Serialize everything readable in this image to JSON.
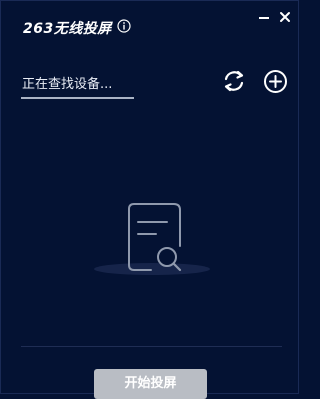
{
  "window": {
    "title": "263无线投屏"
  },
  "status": {
    "text": "正在查找设备..."
  },
  "footer": {
    "start_label": "开始投屏"
  },
  "icons": {
    "info": "info-icon",
    "minimize": "minimize-icon",
    "close": "close-icon",
    "refresh": "refresh-icon",
    "add": "add-circle-icon",
    "empty": "document-search-icon"
  },
  "colors": {
    "background": "#041233",
    "button_disabled": "#b9bdc4",
    "underline": "#aab3c5"
  }
}
